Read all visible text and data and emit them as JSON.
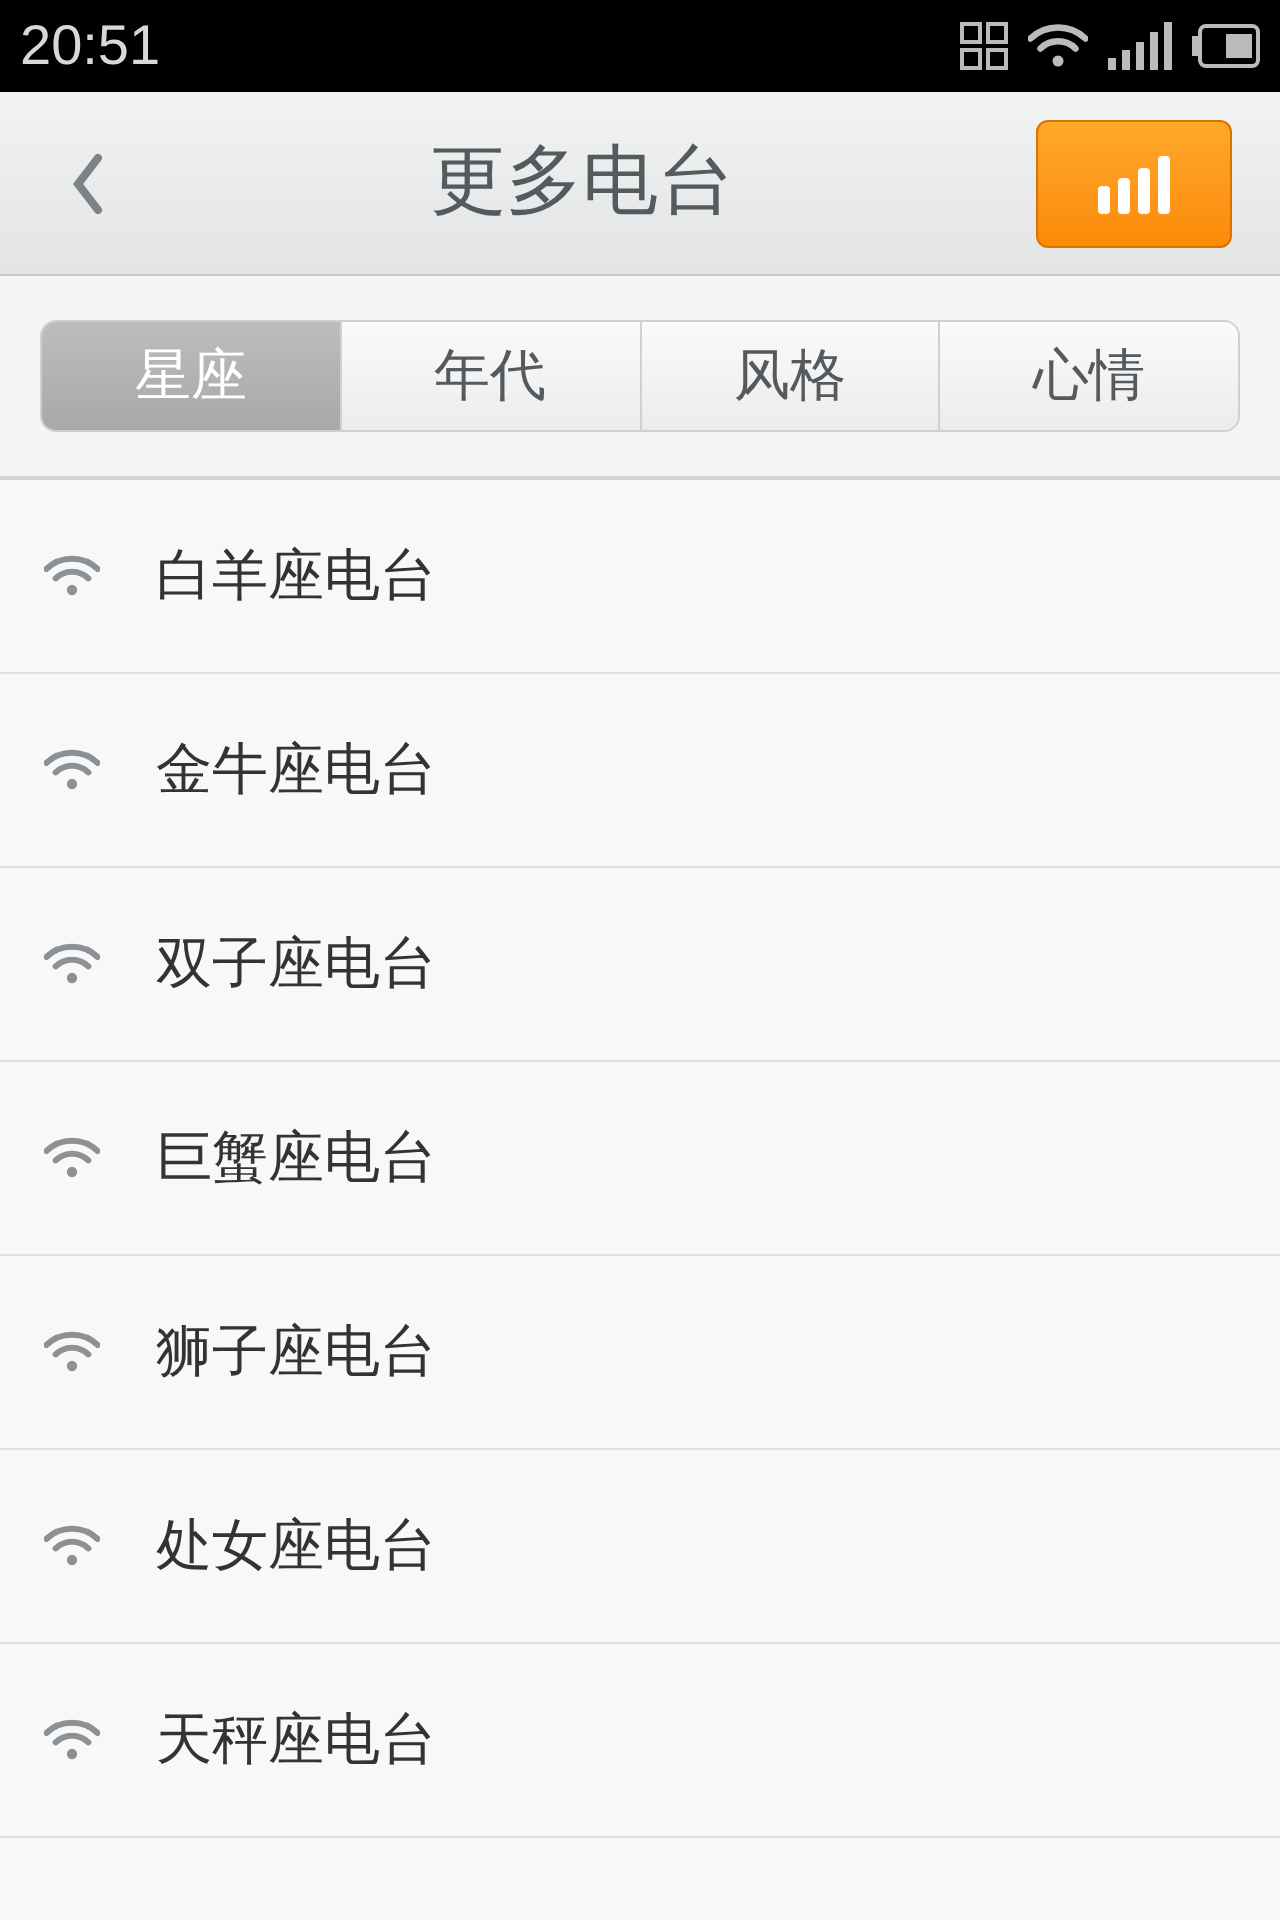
{
  "status_bar": {
    "time": "20:51"
  },
  "header": {
    "title": "更多电台"
  },
  "tabs": [
    {
      "label": "星座",
      "selected": true
    },
    {
      "label": "年代",
      "selected": false
    },
    {
      "label": "风格",
      "selected": false
    },
    {
      "label": "心情",
      "selected": false
    }
  ],
  "stations": [
    {
      "name": "白羊座电台"
    },
    {
      "name": "金牛座电台"
    },
    {
      "name": "双子座电台"
    },
    {
      "name": "巨蟹座电台"
    },
    {
      "name": "狮子座电台"
    },
    {
      "name": "处女座电台"
    },
    {
      "name": "天秤座电台"
    }
  ]
}
